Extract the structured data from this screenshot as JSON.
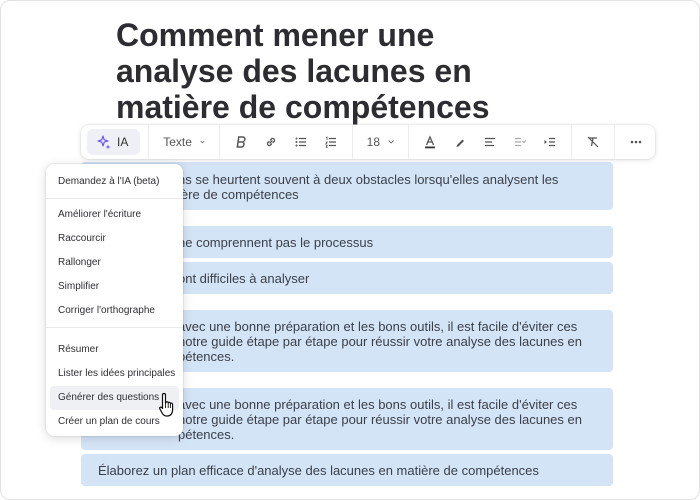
{
  "title_lines": [
    "Comment mener une",
    "analyse des lacunes en",
    "matière de compétences"
  ],
  "toolbar": {
    "ai_label": "IA",
    "text_style": "Texte",
    "font_size": "18",
    "icons": [
      "sparkle-icon",
      "bold-icon",
      "link-icon",
      "bullet-list-icon",
      "numbered-list-icon",
      "text-color-icon",
      "highlight-icon",
      "align-left-icon",
      "checklist-icon",
      "indent-icon",
      "clear-format-icon",
      "more-icon"
    ]
  },
  "ai_menu": {
    "header": "Demandez à l'IA (beta)",
    "group1": [
      "Améliorer l'écriture",
      "Raccourcir",
      "Rallonger",
      "Simplifier",
      "Corriger l'orthographe"
    ],
    "group2": [
      "Résumer",
      "Lister les idées principales",
      "Générer des questions",
      "Créer un plan de cours"
    ]
  },
  "blocks": {
    "b1": [
      "ns se heurtent souvent à deux obstacles lorsqu'elles analysent les",
      "ière de compétences"
    ],
    "b2": "ne comprennent pas le processus",
    "b3": "ont difficiles à analyser",
    "b4": [
      " avec une bonne préparation et les bons outils, il est facile d'éviter ces",
      "notre guide étape par étape pour réussir votre analyse des lacunes en",
      "pétences."
    ],
    "b5": [
      " avec une bonne préparation et les bons outils, il est facile d'éviter ces",
      "notre guide étape par étape pour réussir votre analyse des lacunes en",
      "pétences."
    ],
    "b6": "Élaborez un plan efficace d'analyse des lacunes en matière de compétences"
  },
  "colors": {
    "block_bg": "#d4e4f7",
    "ai_accent": "#6a4cf5",
    "menu_active": "#eef0f4"
  }
}
